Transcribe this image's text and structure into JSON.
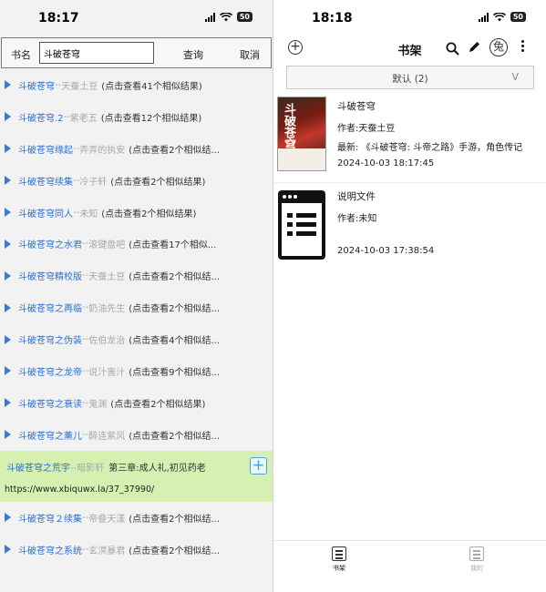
{
  "left": {
    "status": {
      "time": "18:17",
      "battery": "50"
    },
    "search": {
      "label": "书名",
      "value": "斗破苍穹",
      "query_button": "查询",
      "cancel_button": "取消"
    },
    "results": [
      {
        "title": "斗破苍穹",
        "sep": "--",
        "author": "天蚕土豆",
        "count": "(点击查看41个相似结果)"
      },
      {
        "title": "斗破苍穹.2",
        "sep": "--",
        "author": "紫老五",
        "count": "(点击查看12个相似结果)"
      },
      {
        "title": "斗破苍穹缘起",
        "sep": "--",
        "author": "弄弄的执安",
        "count": "(点击查看2个相似结..."
      },
      {
        "title": "斗破苍穹续集",
        "sep": "--",
        "author": "冷子轩",
        "count": "(点击查看2个相似结果)"
      },
      {
        "title": "斗破苍穹同人",
        "sep": "--",
        "author": "未知",
        "count": "(点击查看2个相似结果)"
      },
      {
        "title": "斗破苍穹之水君",
        "sep": "--",
        "author": "滚键盘吧",
        "count": "(点击查看17个相似..."
      },
      {
        "title": "斗破苍穹精校版",
        "sep": "--",
        "author": "天蚕土豆",
        "count": "(点击查看2个相似结..."
      },
      {
        "title": "斗破苍穹之再临",
        "sep": "--",
        "author": "奶油先生",
        "count": "(点击查看2个相似结..."
      },
      {
        "title": "斗破苍穹之伪装",
        "sep": "--",
        "author": "佐伯龙治",
        "count": "(点击查看4个相似结..."
      },
      {
        "title": "斗破苍穹之龙帝",
        "sep": "--",
        "author": "说汁害汁",
        "count": "(点击查看9个相似结..."
      },
      {
        "title": "斗破苍穹之衰读",
        "sep": "--",
        "author": "鬼渊",
        "count": "(点击查看2个相似结果)"
      },
      {
        "title": "斗破苍穹之薰儿",
        "sep": "--",
        "author": "醉连紫风",
        "count": "(点击查看2个相似结..."
      }
    ],
    "expanded": {
      "title": "斗破苍穹之荒宇",
      "sep": "--",
      "author": "暗影轩",
      "chapter": "第三章:成人礼,初见药老",
      "url": "https://www.xbiquwx.la/37_37990/",
      "add_icon": "+"
    },
    "results_after": [
      {
        "title": "斗破苍穹２续集",
        "sep": "--",
        "author": "帝叠天漾",
        "count": "(点击查看2个相似结..."
      },
      {
        "title": "斗破苍穹之系统",
        "sep": "--",
        "author": "玄溟暴君",
        "count": "(点击查看2个相似结..."
      }
    ]
  },
  "right": {
    "status": {
      "time": "18:18",
      "battery": "50"
    },
    "toolbar": {
      "title": "书架",
      "add_icon": "+",
      "rabbit_icon": "兔"
    },
    "group": {
      "label": "默认 (2)",
      "toggle": "V"
    },
    "books": [
      {
        "title": "斗破苍穹",
        "author": "作者:天蚕土豆",
        "latest": "最新: 《斗破苍穹: 斗帝之路》手游，角色传记",
        "time": "2024-10-03 18:17:45",
        "cover_text": "斗破苍穹"
      },
      {
        "title": "说明文件",
        "author": "作者:未知",
        "latest": "",
        "time": "2024-10-03 17:38:54"
      }
    ],
    "nav": [
      {
        "label": "书架"
      },
      {
        "label": "我的"
      }
    ]
  },
  "colors": {
    "link_blue": "#2a6fd0",
    "highlight_green": "#d5f0b0",
    "triangle_blue": "#3b7ad0"
  }
}
